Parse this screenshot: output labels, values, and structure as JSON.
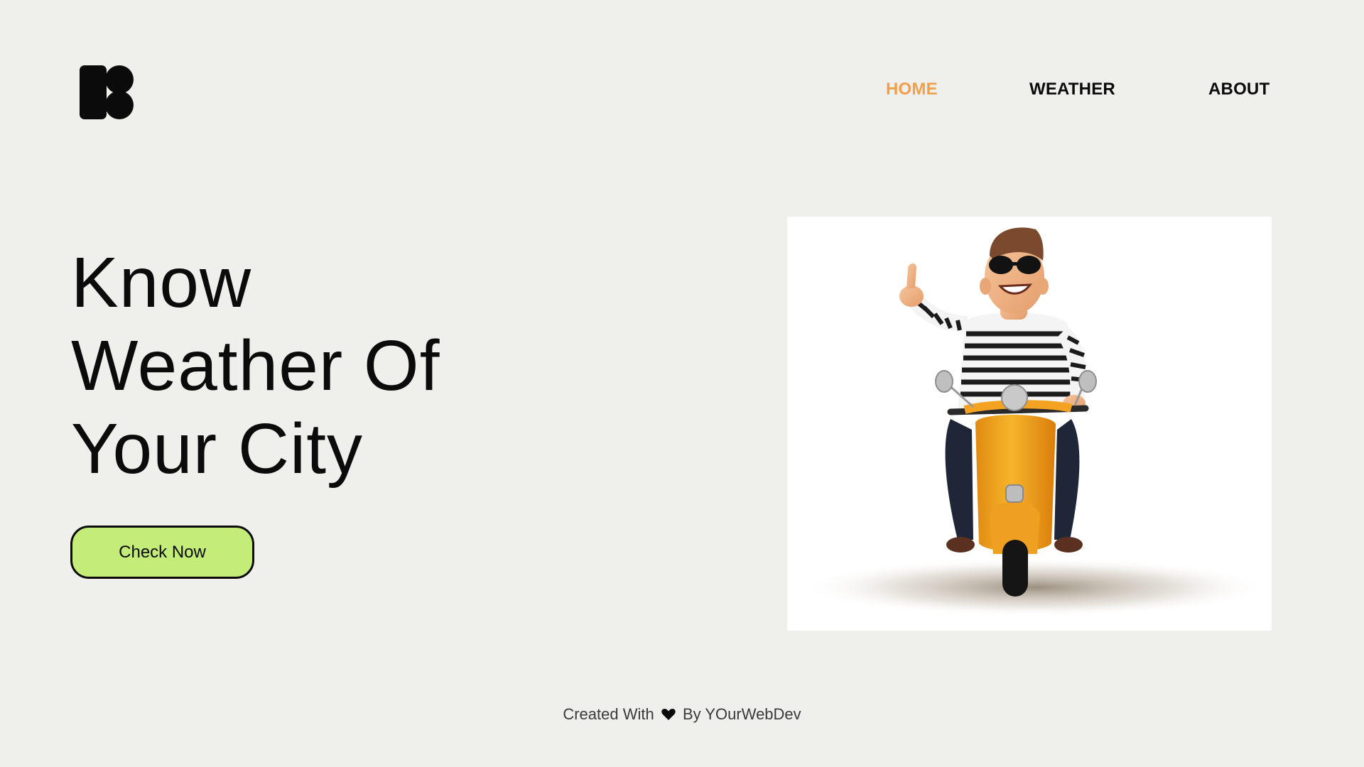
{
  "header": {
    "logo_icon": "brand-logo-icon",
    "nav": [
      {
        "label": "HOME",
        "active": true
      },
      {
        "label": "WEATHER",
        "active": false
      },
      {
        "label": "ABOUT",
        "active": false
      }
    ]
  },
  "hero": {
    "title_lines": [
      "Know",
      "Weather Of",
      "Your City"
    ],
    "cta_label": "Check Now",
    "illustration_icon": "scooter-rider-illustration"
  },
  "footer": {
    "prefix": "Created With",
    "heart_icon": "heart-icon",
    "suffix": "By YOurWebDev"
  },
  "colors": {
    "background": "#efefeb",
    "accent_nav": "#f0a04b",
    "cta_fill": "#c3ec78",
    "text": "#0b0b0b"
  }
}
